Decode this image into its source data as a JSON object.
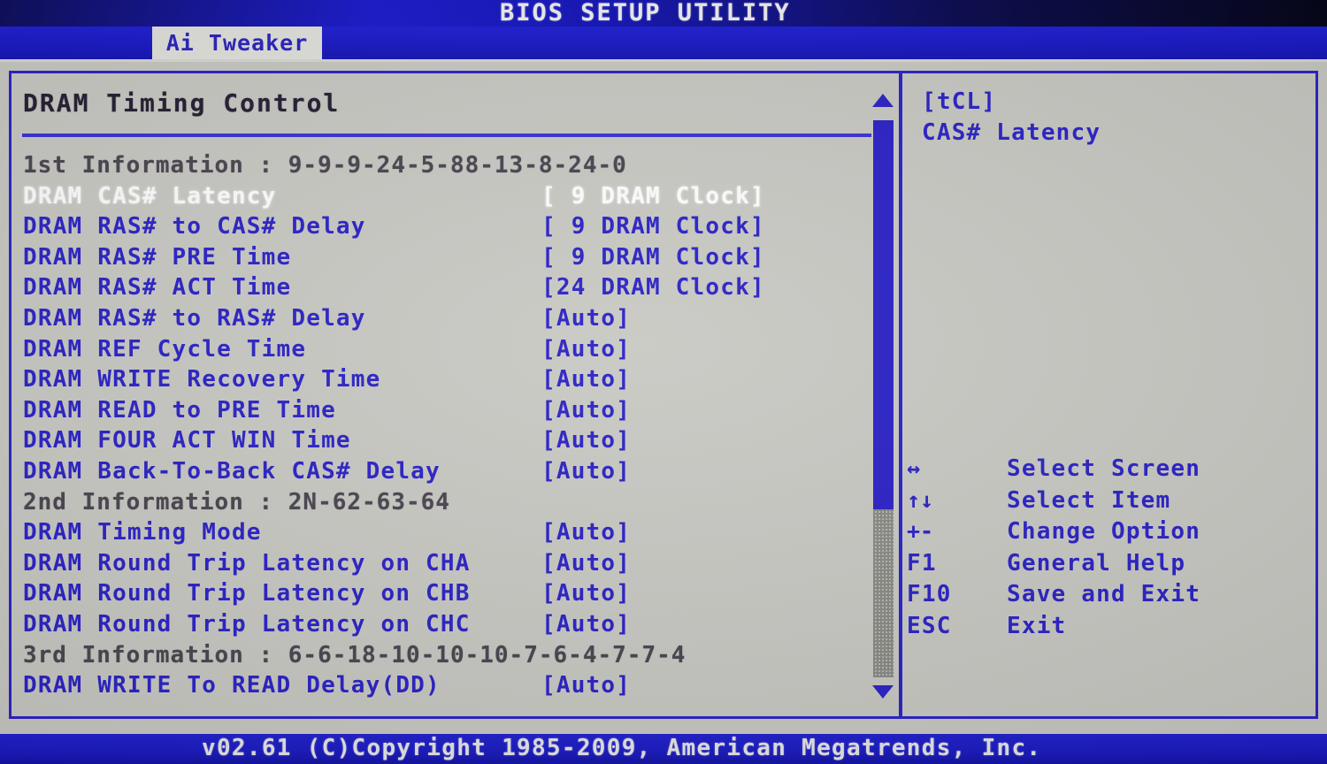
{
  "window": {
    "title": "BIOS SETUP UTILITY"
  },
  "menubar": {
    "active_tab": "Ai Tweaker"
  },
  "main": {
    "section_title": "DRAM Timing Control",
    "items": [
      {
        "kind": "info",
        "label": "1st Information : 9-9-9-24-5-88-13-8-24-0",
        "value": ""
      },
      {
        "kind": "selected",
        "label": "DRAM CAS# Latency",
        "value": "[ 9 DRAM Clock]"
      },
      {
        "kind": "opt",
        "label": "DRAM RAS# to CAS# Delay",
        "value": "[ 9 DRAM Clock]"
      },
      {
        "kind": "opt",
        "label": "DRAM RAS# PRE Time",
        "value": "[ 9 DRAM Clock]"
      },
      {
        "kind": "opt",
        "label": "DRAM RAS# ACT Time",
        "value": "[24 DRAM Clock]"
      },
      {
        "kind": "opt",
        "label": "DRAM RAS# to RAS# Delay",
        "value": "[Auto]"
      },
      {
        "kind": "opt",
        "label": "DRAM REF Cycle Time",
        "value": "[Auto]"
      },
      {
        "kind": "opt",
        "label": "DRAM WRITE Recovery Time",
        "value": "[Auto]"
      },
      {
        "kind": "opt",
        "label": "DRAM READ to PRE Time",
        "value": "[Auto]"
      },
      {
        "kind": "opt",
        "label": "DRAM FOUR ACT WIN Time",
        "value": "[Auto]"
      },
      {
        "kind": "opt",
        "label": "DRAM Back-To-Back CAS# Delay",
        "value": "[Auto]"
      },
      {
        "kind": "info",
        "label": "2nd Information : 2N-62-63-64",
        "value": ""
      },
      {
        "kind": "opt",
        "label": "DRAM Timing Mode",
        "value": "[Auto]"
      },
      {
        "kind": "opt",
        "label": "DRAM Round Trip Latency on CHA",
        "value": "[Auto]"
      },
      {
        "kind": "opt",
        "label": "DRAM Round Trip Latency on CHB",
        "value": "[Auto]"
      },
      {
        "kind": "opt",
        "label": "DRAM Round Trip Latency on CHC",
        "value": "[Auto]"
      },
      {
        "kind": "info",
        "label": "3rd Information : 6-6-18-10-10-10-7-6-4-7-7-4",
        "value": ""
      },
      {
        "kind": "opt",
        "label": "DRAM WRITE To READ Delay(DD)",
        "value": "[Auto]"
      }
    ]
  },
  "scrollbar": {
    "up_arrow": "scroll-up-arrow",
    "down_arrow": "scroll-down-arrow",
    "thumb_position_percent": 0,
    "thumb_size_percent": 70
  },
  "help": {
    "lines": [
      "[tCL]",
      "CAS# Latency"
    ]
  },
  "keylegend": {
    "rows": [
      {
        "key": "↔",
        "action": "Select Screen",
        "glyph": true,
        "name": "left-right-arrow-icon"
      },
      {
        "key": "↑↓",
        "action": "Select Item",
        "glyph": true,
        "name": "up-down-arrow-icon"
      },
      {
        "key": "+-",
        "action": "Change Option",
        "glyph": true,
        "name": "plus-minus-icon"
      },
      {
        "key": "F1",
        "action": "General Help",
        "glyph": false,
        "name": "f1-key"
      },
      {
        "key": "F10",
        "action": "Save and Exit",
        "glyph": false,
        "name": "f10-key"
      },
      {
        "key": "ESC",
        "action": "Exit",
        "glyph": false,
        "name": "esc-key"
      }
    ]
  },
  "footer": {
    "copyright": "v02.61 (C)Copyright 1985-2009, American Megatrends, Inc."
  },
  "colors": {
    "accent_blue": "#2b22c6",
    "panel_bg": "#c9c9c4",
    "title_bar_blue": "#1a1ad0",
    "selected_text": "#ffffff",
    "info_text": "#4a4550"
  }
}
